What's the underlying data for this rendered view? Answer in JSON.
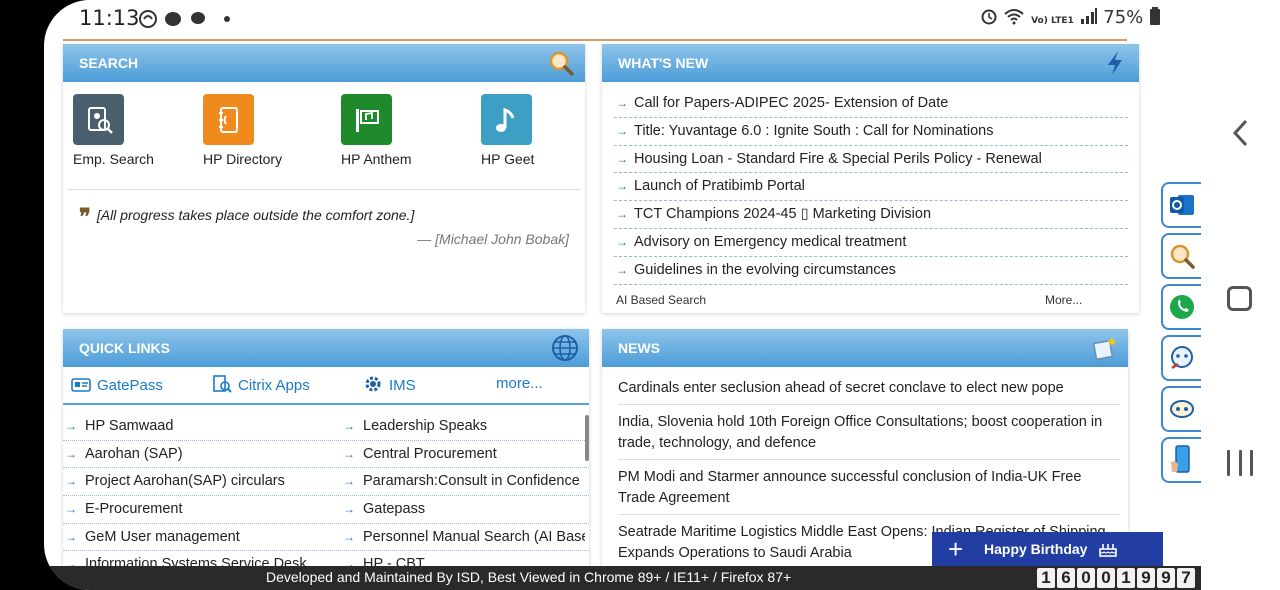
{
  "status_bar": {
    "time": "11:13",
    "battery": "75%",
    "icons_left": "◔ ● ● •",
    "signal": "Vo) LTE1"
  },
  "search_panel": {
    "title": "SEARCH",
    "tiles": [
      {
        "label": "Emp. Search",
        "color": "#4a5f6e",
        "icon": "employee-search-icon"
      },
      {
        "label": "HP Directory",
        "color": "#f08a1c",
        "icon": "directory-icon"
      },
      {
        "label": "HP Anthem",
        "color": "#1f8a2c",
        "icon": "anthem-icon"
      },
      {
        "label": "HP Geet",
        "color": "#3d9fc4",
        "icon": "music-note-icon"
      }
    ],
    "quote": "[All progress takes place outside the comfort zone.]",
    "author": "— [Michael John Bobak]"
  },
  "whats_new": {
    "title": "WHAT'S NEW",
    "items": [
      "Call for Papers-ADIPEC 2025- Extension of Date",
      "Title: Yuvantage 6.0 : Ignite South : Call for Nominations",
      "Housing Loan - Standard Fire & Special Perils Policy - Renewal",
      "Launch of Pratibimb Portal",
      "TCT Champions 2024-45 ▯ Marketing Division",
      "Advisory on Emergency medical treatment",
      "Guidelines in the evolving circumstances"
    ],
    "ai_search": "AI Based Search",
    "more": "More..."
  },
  "quick_links": {
    "title": "QUICK LINKS",
    "top": [
      {
        "label": "GatePass"
      },
      {
        "label": "Citrix Apps"
      },
      {
        "label": "IMS"
      },
      {
        "label": "more..."
      }
    ],
    "left": [
      "HP Samwaad",
      "Aarohan (SAP)",
      "Project Aarohan(SAP) circulars",
      "E-Procurement",
      "GeM User management",
      "Information Systems Service Desk"
    ],
    "right": [
      "Leadership Speaks",
      "Central Procurement",
      "Paramarsh:Consult in Confidence",
      "Gatepass",
      "Personnel Manual Search (AI Based)",
      "HP - CBT"
    ]
  },
  "news": {
    "title": "NEWS",
    "items": [
      "Cardinals enter seclusion ahead of secret conclave to elect new pope",
      "India, Slovenia hold 10th Foreign Office Consultations; boost cooperation in trade, technology, and defence",
      "PM Modi and Starmer announce successful conclusion of India-UK Free Trade Agreement",
      "Seatrade Maritime Logistics Middle East Opens: Indian Register of Shipping Expands Operations to Saudi Arabia"
    ]
  },
  "birthday": {
    "label": "Happy Birthday"
  },
  "footer": {
    "text": "Developed and Maintained By ISD, Best Viewed in Chrome 89+ / IE11+ / Firefox 87+",
    "counter": [
      "1",
      "6",
      "0",
      "0",
      "1",
      "9",
      "9",
      "7"
    ]
  },
  "colors": {
    "header": "#4d9cd8",
    "birthday": "#233ea3",
    "link": "#1a7ac9"
  }
}
